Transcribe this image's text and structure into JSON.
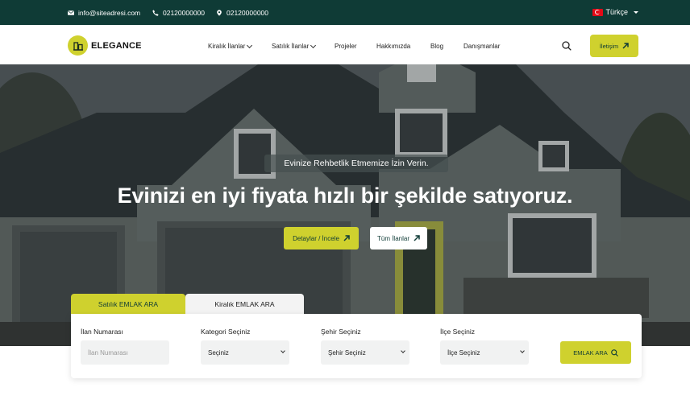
{
  "topbar": {
    "email": "info@siteadresi.com",
    "phone1": "02120000000",
    "phone2": "02120000000",
    "language": "Türkçe"
  },
  "header": {
    "logo_text": "ELEGANCE",
    "nav": [
      {
        "label": "Kiralık İlanlar",
        "has_dropdown": true
      },
      {
        "label": "Satılık İlanlar",
        "has_dropdown": true
      },
      {
        "label": "Projeler",
        "has_dropdown": false
      },
      {
        "label": "Hakkımızda",
        "has_dropdown": false
      },
      {
        "label": "Blog",
        "has_dropdown": false
      },
      {
        "label": "Danışmanlar",
        "has_dropdown": false
      }
    ],
    "contact_label": "İletişim"
  },
  "hero": {
    "badge": "Evinize Rehbetlik Etmemize İzin Verin.",
    "headline": "Evinizi en iyi fiyata hızlı bir şekilde satıyoruz.",
    "detail_button": "Detaylar / İncele",
    "all_button": "Tüm İlanlar"
  },
  "search": {
    "tabs": [
      "Satılık EMLAK ARA",
      "Kiralık EMLAK ARA"
    ],
    "active_tab": 0,
    "fields": [
      {
        "label": "İlan Numarası",
        "placeholder": "İlan Numarası",
        "type": "input"
      },
      {
        "label": "Kategori Seçiniz",
        "value": "Seçiniz",
        "type": "select"
      },
      {
        "label": "Şehir Seçiniz",
        "value": "Şehir Seçiniz",
        "type": "select"
      },
      {
        "label": "İlçe Seçiniz",
        "value": "İlçe Seçiniz",
        "type": "select"
      }
    ],
    "submit_label": "EMLAK ARA"
  },
  "colors": {
    "accent": "#cfd12e",
    "dark": "#0f3b36"
  }
}
